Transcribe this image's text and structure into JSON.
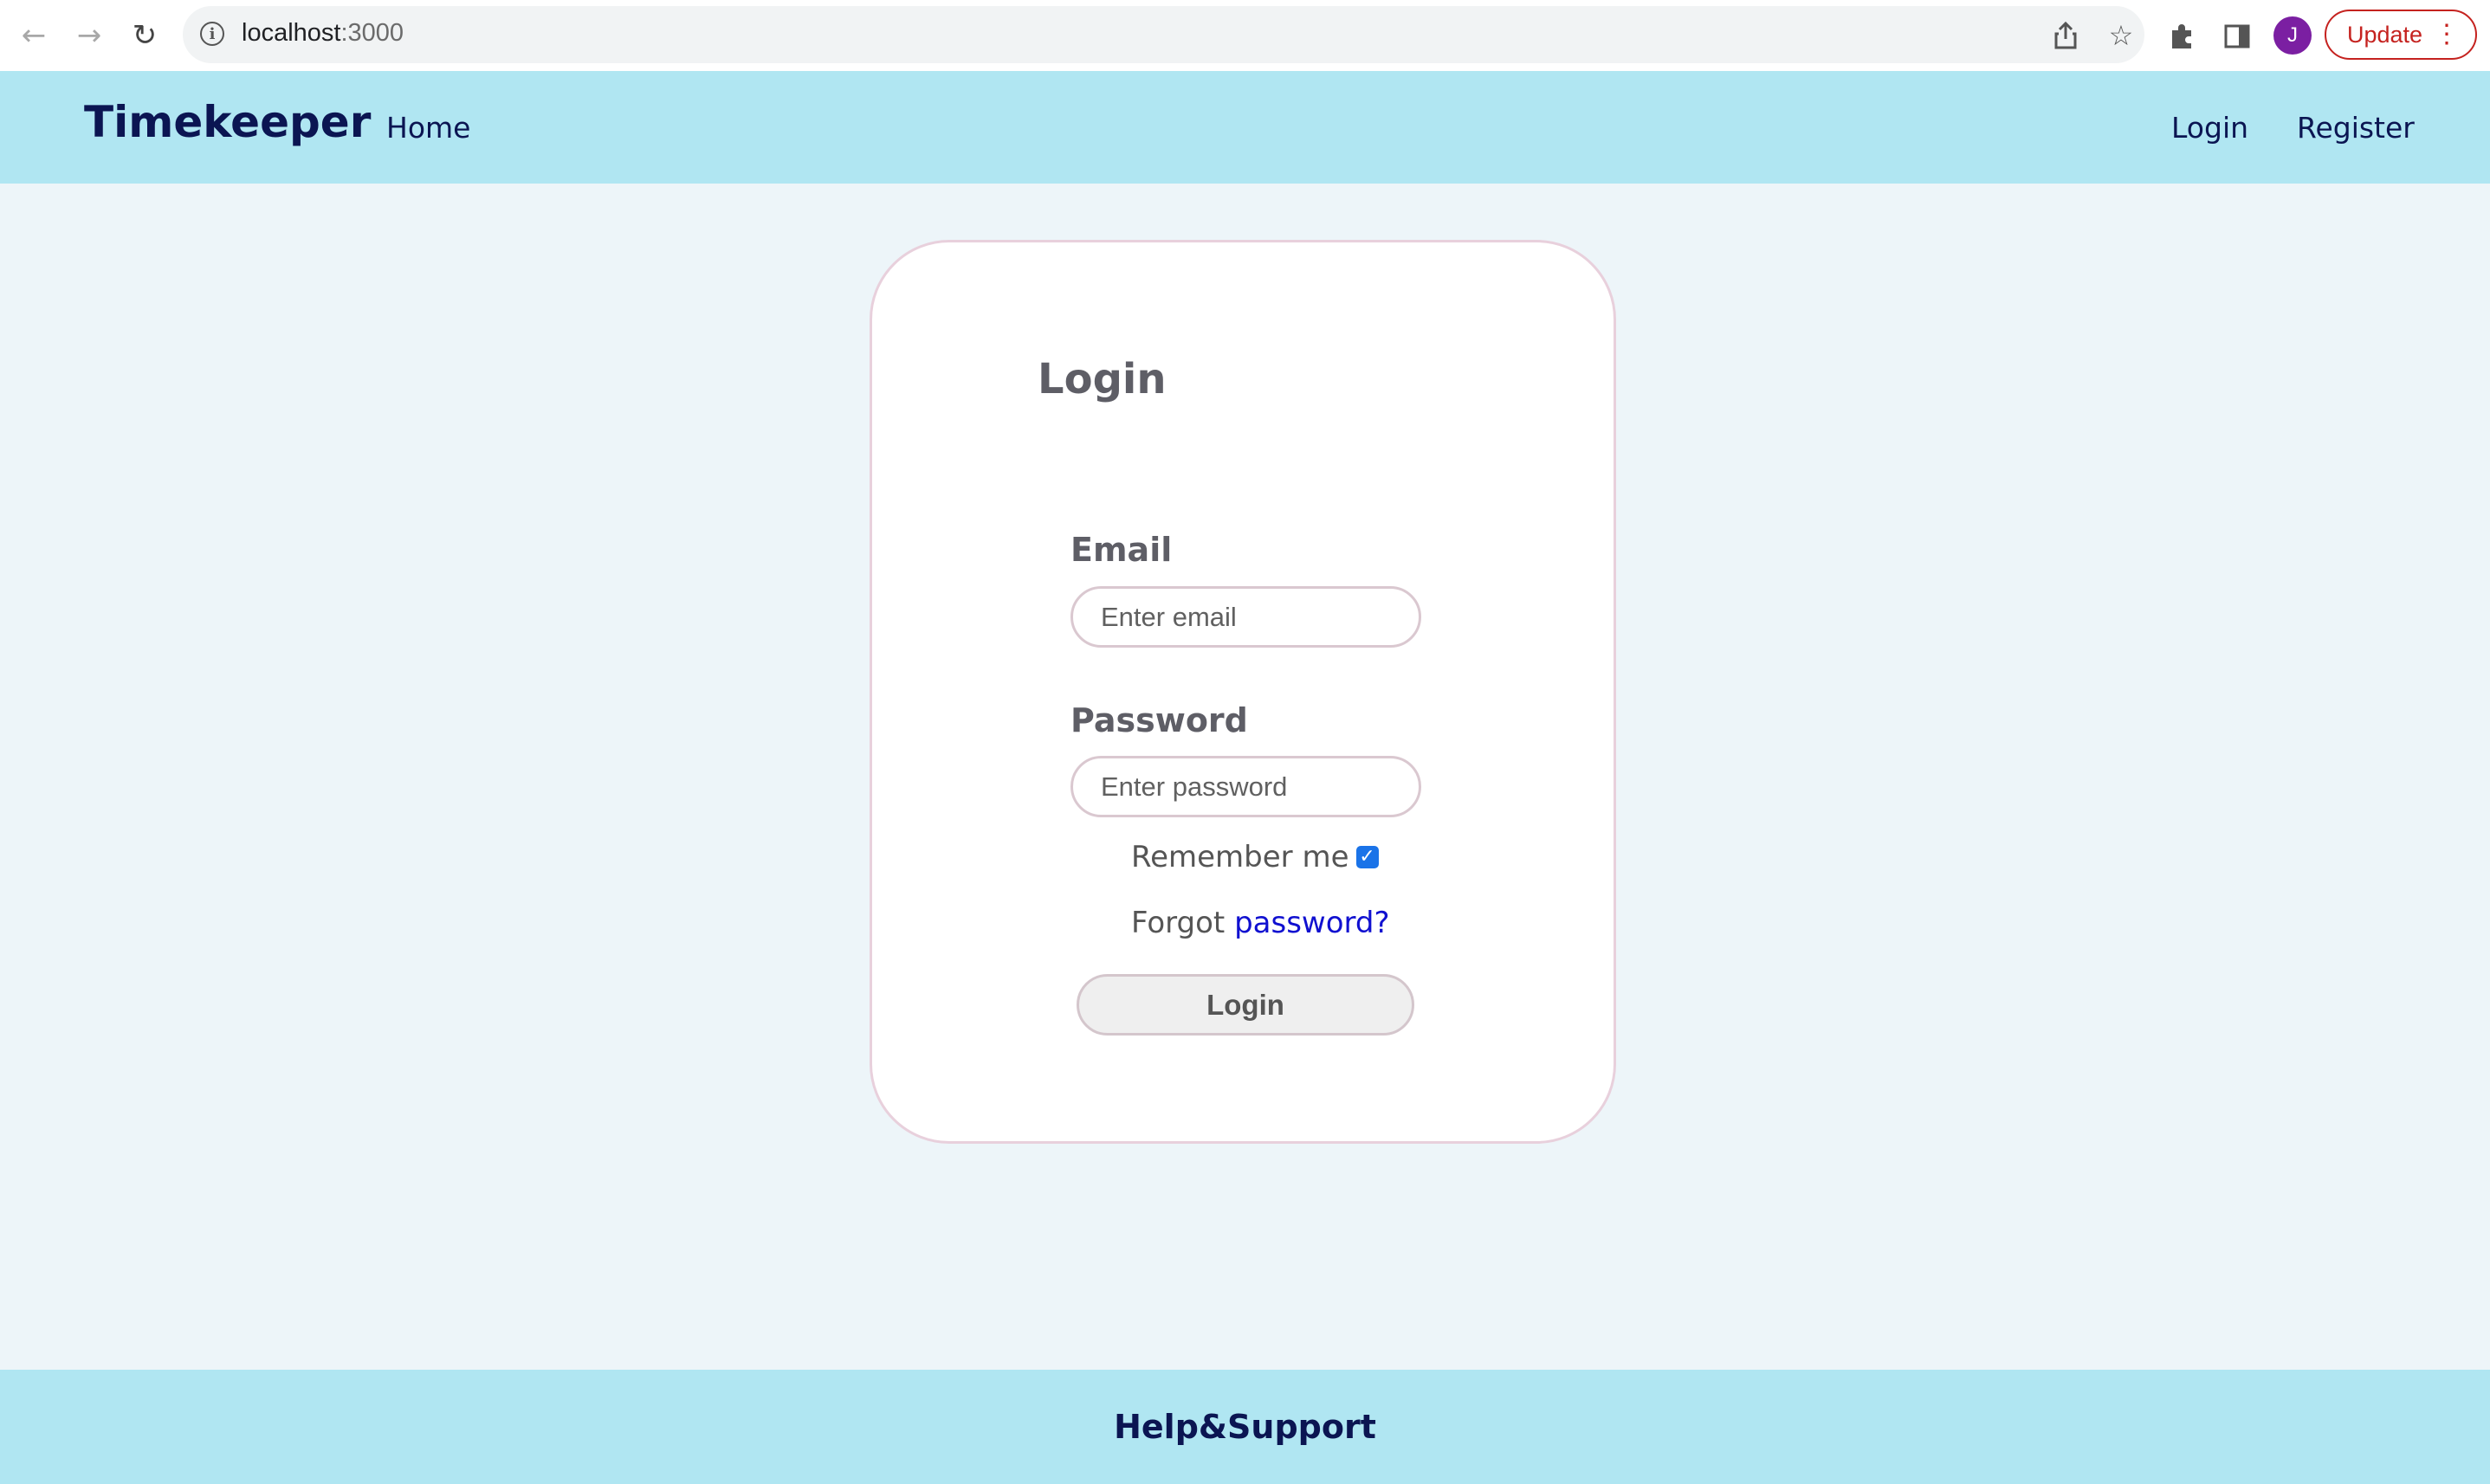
{
  "browser": {
    "url_host": "localhost",
    "url_port": ":3000",
    "update_label": "Update",
    "avatar_initial": "J"
  },
  "header": {
    "brand": "Timekeeper",
    "nav_home": "Home",
    "nav_login": "Login",
    "nav_register": "Register"
  },
  "login_form": {
    "title": "Login",
    "email_label": "Email",
    "email_placeholder": "Enter email",
    "email_value": "",
    "password_label": "Password",
    "password_placeholder": "Enter password",
    "password_value": "",
    "remember_label": "Remember me",
    "remember_checked": true,
    "forgot_prefix": "Forgot",
    "forgot_link": "password?",
    "submit_label": "Login"
  },
  "footer": {
    "help_link": "Help&Support"
  },
  "colors": {
    "header_bg": "#b0e6f2",
    "page_bg": "#edf5f9",
    "brand_text": "#0b1552",
    "link": "#1010d0",
    "checkbox": "#1a73e8",
    "update_red": "#c5221f"
  },
  "icons": {
    "back": "arrow-left-icon",
    "forward": "arrow-right-icon",
    "reload": "reload-icon",
    "site_info": "info-icon",
    "share": "share-icon",
    "bookmark": "star-icon",
    "extensions": "puzzle-icon",
    "side_panel": "side-panel-icon",
    "menu": "kebab-menu-icon"
  }
}
